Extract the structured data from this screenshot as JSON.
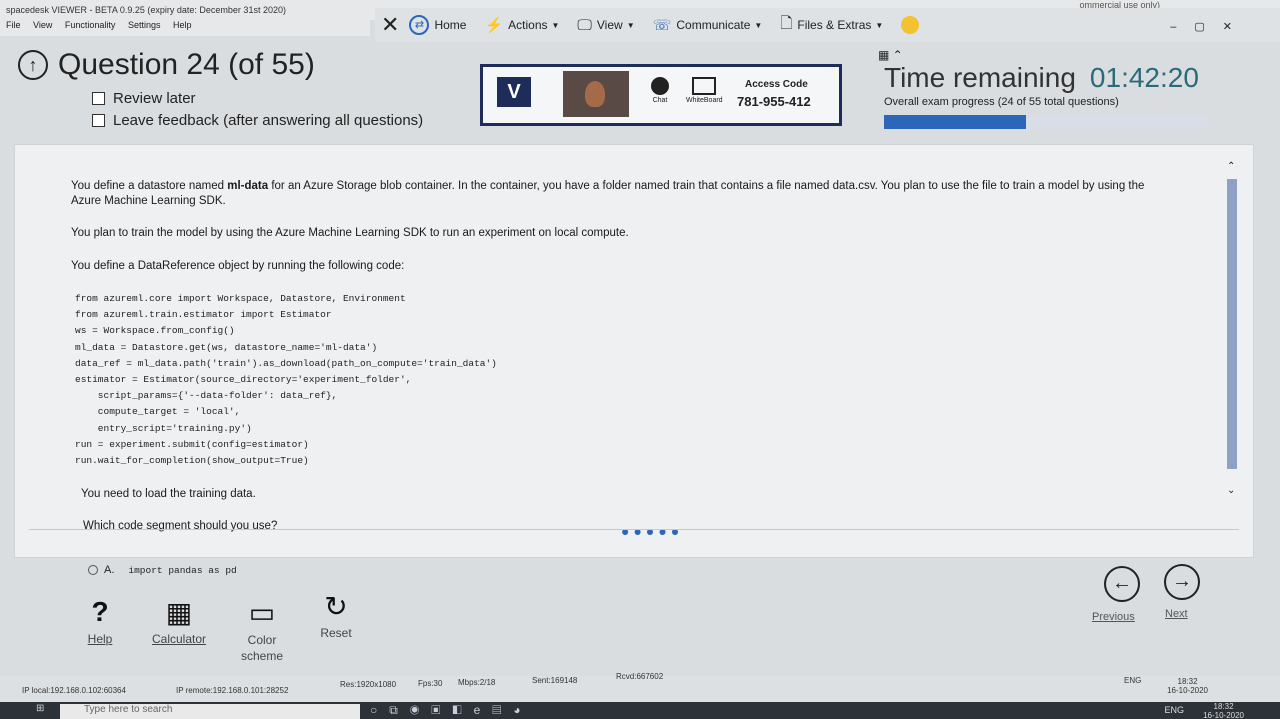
{
  "viewer": {
    "title": "spacedesk VIEWER - BETA 0.9.25 (expiry date: December 31st 2020)",
    "license_note": "ommercial use only)",
    "menu": [
      "File",
      "View",
      "Functionality",
      "Settings",
      "Help"
    ]
  },
  "toolbar": {
    "home": "Home",
    "actions": "Actions",
    "view": "View",
    "communicate": "Communicate",
    "files": "Files & Extras"
  },
  "exam": {
    "question_title": "Question 24 (of 55)",
    "review_later": "Review later",
    "leave_feedback": "Leave feedback (after answering all questions)",
    "access_code_label": "Access Code",
    "access_code": "781-955-412",
    "chat_label": "Chat",
    "whiteboard_label": "WhiteBoard",
    "time_label": "Time remaining",
    "time_value": "01:42:20",
    "progress_label": "Overall exam progress (24 of 55 total questions)",
    "progress_fraction": 0.4364
  },
  "question": {
    "para1_pre": "You define a datastore named ",
    "para1_bold": "ml-data",
    "para1_post": " for an Azure Storage blob container. In the container, you have a folder named train that contains a file named data.csv. You plan to use the file to train a model by using the Azure Machine Learning SDK.",
    "para2": "You plan to train the model by using the Azure Machine Learning SDK to run an experiment on local compute.",
    "para3": "You define a DataReference object by running the following code:",
    "code": "from azureml.core import Workspace, Datastore, Environment\nfrom azureml.train.estimator import Estimator\nws = Workspace.from_config()\nml_data = Datastore.get(ws, datastore_name='ml-data')\ndata_ref = ml_data.path('train').as_download(path_on_compute='train_data')\nestimator = Estimator(source_directory='experiment_folder',\n    script_params={'--data-folder': data_ref},\n    compute_target = 'local',\n    entry_script='training.py')\nrun = experiment.submit(config=estimator)\nrun.wait_for_completion(show_output=True)",
    "para4": "You need to load the training data.",
    "para5": "Which code segment should you use?"
  },
  "answer": {
    "option_letter": "A.",
    "option_code": "import pandas as pd"
  },
  "tools": {
    "help": "Help",
    "calculator": "Calculator",
    "color_scheme": "Color scheme",
    "reset": "Reset",
    "previous": "Previous",
    "next": "Next"
  },
  "status": {
    "ip_local": "IP local:192.168.0.102:60364",
    "ip_remote": "IP remote:192.168.0.101:28252",
    "res": "Res:1920x1080",
    "fps": "Fps:30",
    "mbps": "Mbps:2/18",
    "sent": "Sent:169148",
    "rcvd": "Rcvd:667602",
    "lang": "ENG",
    "time": "18:32",
    "date": "16-10-2020"
  },
  "taskbar": {
    "search_placeholder": "Type here to search",
    "lang": "ENG",
    "time": "18:32",
    "date": "16-10-2020"
  },
  "colors": {
    "accent_blue": "#2c66b8",
    "access_border": "#1e2c5a",
    "time_value": "#2a6a7a"
  }
}
